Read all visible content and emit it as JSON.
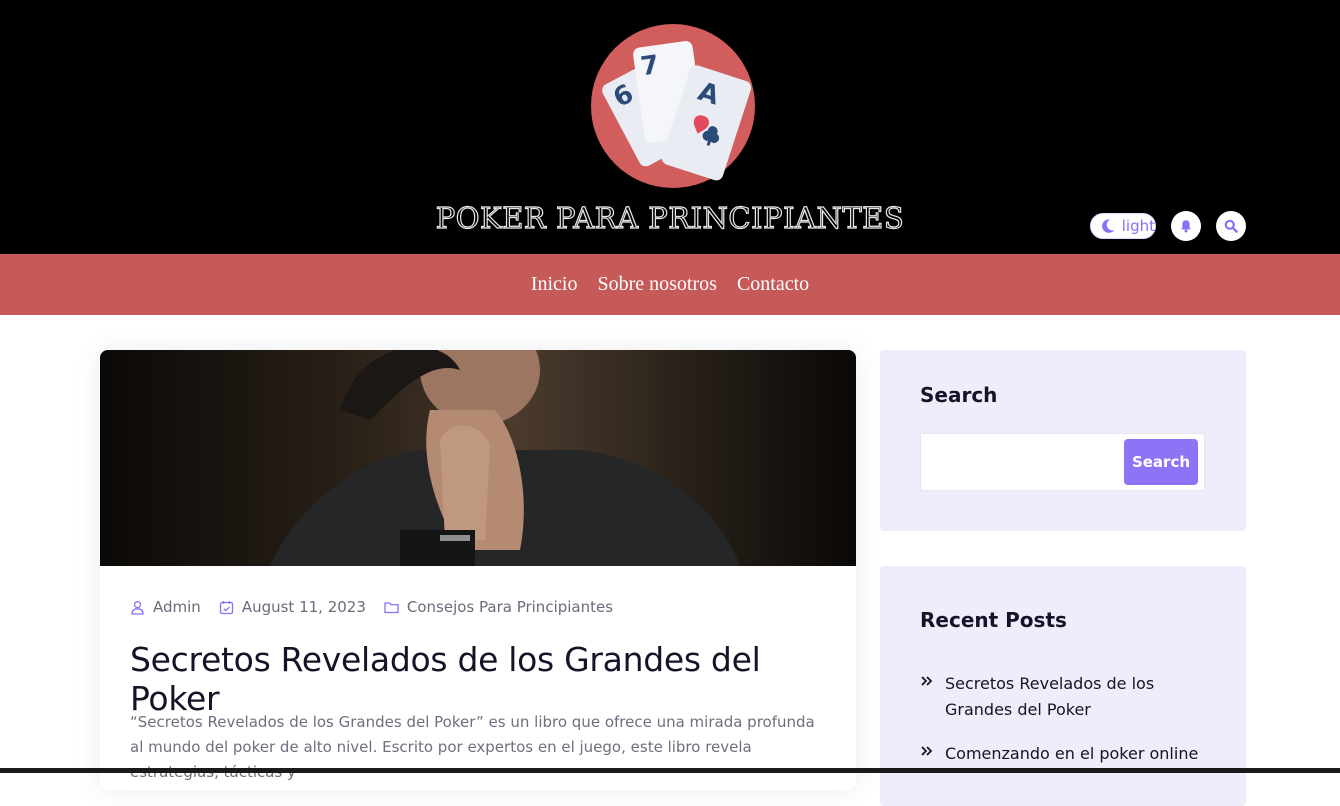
{
  "header": {
    "site_title": "POKER PARA PRINCIPIANTES",
    "mode_toggle_label": "light",
    "logo_cards": [
      "6",
      "7",
      "A"
    ]
  },
  "nav": {
    "items": [
      {
        "label": "Inicio"
      },
      {
        "label": "Sobre nosotros"
      },
      {
        "label": "Contacto"
      }
    ]
  },
  "post": {
    "author": "Admin",
    "date": "August 11, 2023",
    "category": "Consejos Para Principiantes",
    "title": "Secretos Revelados de los Grandes del Poker",
    "excerpt": "“Secretos Revelados de los Grandes del Poker” es un libro que ofrece una mirada profunda al mundo del poker de alto nivel. Escrito por expertos en el juego, este libro revela estrategias, tácticas y"
  },
  "sidebar": {
    "search": {
      "title": "Search",
      "button_label": "Search",
      "input_value": ""
    },
    "recent": {
      "title": "Recent Posts",
      "items": [
        {
          "label": "Secretos Revelados de los Grandes del Poker"
        },
        {
          "label": "Comenzando en el poker online"
        }
      ]
    }
  },
  "colors": {
    "header_bg": "#000000",
    "nav_bg": "#c65a58",
    "accent": "#8f73f7",
    "widget_bg": "#efecfb",
    "logo_circle": "#d15e5c"
  }
}
